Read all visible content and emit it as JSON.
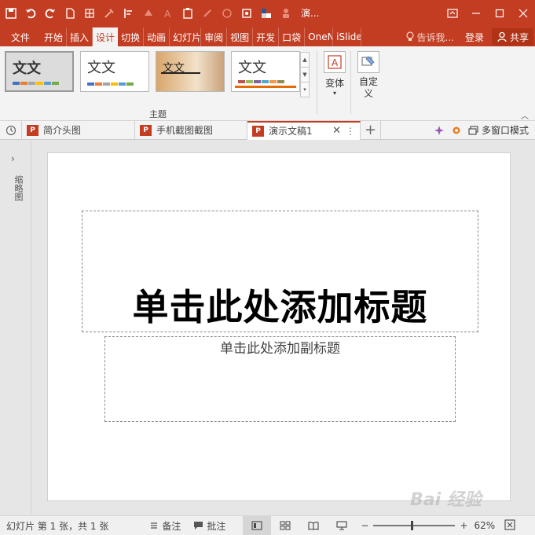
{
  "titlebar": {
    "title": "演...",
    "icons": [
      "save-icon",
      "undo-icon",
      "redo-icon",
      "new-doc-icon",
      "grid-icon",
      "eyedropper-icon",
      "align-icon",
      "paint-icon",
      "font-icon",
      "paste-icon",
      "brush-icon",
      "shape-icon",
      "screen-icon",
      "fill-icon",
      "person-icon"
    ]
  },
  "tabs": {
    "file": "文件",
    "items": [
      "开始",
      "插入",
      "设计",
      "切换",
      "动画",
      "幻灯片",
      "审阅",
      "视图",
      "开发",
      "口袋",
      "OneNote",
      "iSlide"
    ],
    "active": "设计",
    "tell_me": "告诉我...",
    "login": "登录",
    "share": "共享"
  },
  "ribbon": {
    "themes_group_label": "主题",
    "theme_glyph": "文文",
    "variants_label": "变体",
    "customize_label": "自定义"
  },
  "doc_tabs": {
    "items": [
      "简介头图",
      "手机截图截图",
      "演示文稿1"
    ],
    "active": "演示文稿1",
    "multi_window": "多窗口模式"
  },
  "left_pane": {
    "label": "缩略图"
  },
  "slide": {
    "title_placeholder": "单击此处添加标题",
    "subtitle_placeholder": "单击此处添加副标题"
  },
  "watermark": "Bai 经验",
  "status": {
    "slide_info": "幻灯片 第 1 张，共 1 张",
    "notes": "备注",
    "comments": "批注",
    "zoom": "62%",
    "zoom_minus": "−",
    "zoom_plus": "+"
  },
  "colors": {
    "accent": "#c33d22",
    "ribbon_bg": "#f3f3f3",
    "workspace": "#e6e6e6"
  }
}
